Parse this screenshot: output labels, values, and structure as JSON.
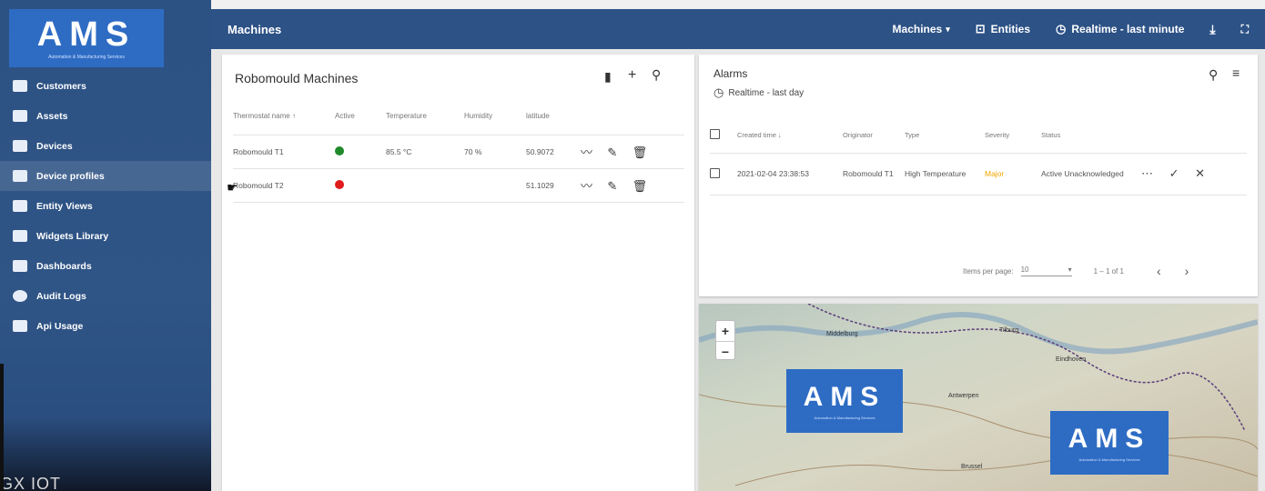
{
  "sidebar": {
    "logo_text": "AMS",
    "logo_sub": "Automation & Manufacturing Services",
    "items": [
      {
        "label": "Customers",
        "icon": "customers-icon"
      },
      {
        "label": "Assets",
        "icon": "assets-icon"
      },
      {
        "label": "Devices",
        "icon": "devices-icon"
      },
      {
        "label": "Device profiles",
        "icon": "device-profiles-icon"
      },
      {
        "label": "Entity Views",
        "icon": "entity-views-icon"
      },
      {
        "label": "Widgets Library",
        "icon": "widgets-library-icon"
      },
      {
        "label": "Dashboards",
        "icon": "dashboards-icon"
      },
      {
        "label": "Audit Logs",
        "icon": "audit-logs-icon"
      },
      {
        "label": "Api Usage",
        "icon": "api-usage-icon"
      }
    ],
    "footer": "GX IOT"
  },
  "topbar": {
    "title": "Machines",
    "machines_menu": "Machines",
    "entities": "Entities",
    "realtime": "Realtime - last minute"
  },
  "machines": {
    "title": "Robomould Machines",
    "columns": [
      "Thermostat name",
      "Active",
      "Temperature",
      "Humidity",
      "latitude"
    ],
    "rows": [
      {
        "name": "Robomould T1",
        "active": true,
        "temperature": "85.5 °C",
        "humidity": "70 %",
        "latitude": "50.9072"
      },
      {
        "name": "Robomould T2",
        "active": false,
        "temperature": "",
        "humidity": "",
        "latitude": "51.1029"
      }
    ]
  },
  "alarms": {
    "title": "Alarms",
    "timewindow": "Realtime - last day",
    "columns": [
      "Created time",
      "Originator",
      "Type",
      "Severity",
      "Status"
    ],
    "rows": [
      {
        "created": "2021-02-04 23:38:53",
        "originator": "Robomould T1",
        "type": "High Temperature",
        "severity": "Major",
        "status": "Active Unacknowledged"
      }
    ],
    "pager": {
      "label": "Items per page:",
      "value": "10",
      "range": "1 – 1 of 1"
    }
  },
  "map": {
    "zoom_in": "+",
    "zoom_out": "−",
    "tile_text": "AMS",
    "tile_sub": "Automation & Manufacturing Services",
    "labels": [
      "Middelburg",
      "Antwerpen",
      "Eindhoven",
      "Tilburg",
      "Brussel"
    ]
  },
  "colors": {
    "sidebar": "#2c5283",
    "topbar": "#2d5286",
    "logo": "#2e6cc4",
    "active_green": "#1e8a2a",
    "inactive_red": "#e01b1b",
    "severity_major": "#f0a800"
  }
}
